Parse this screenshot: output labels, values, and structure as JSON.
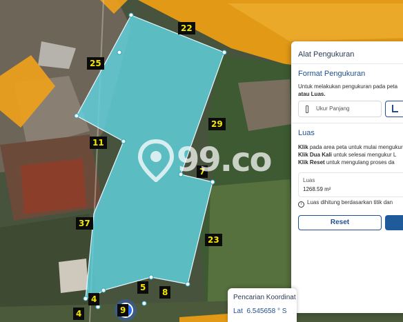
{
  "colors": {
    "parcel_fill": "#5fd3df",
    "parcel_stroke": "#e8f8ff",
    "zone_orange": "#f0a21a",
    "label_bg": "#0b0b0b",
    "label_text": "#f2e600",
    "accent": "#1f4f8f"
  },
  "parcel_labels": [
    {
      "id": "22",
      "text": "22"
    },
    {
      "id": "25",
      "text": "25"
    },
    {
      "id": "29",
      "text": "29"
    },
    {
      "id": "11",
      "text": "11"
    },
    {
      "id": "7",
      "text": "7"
    },
    {
      "id": "37",
      "text": "37"
    },
    {
      "id": "23",
      "text": "23"
    },
    {
      "id": "5",
      "text": "5"
    },
    {
      "id": "8",
      "text": "8"
    },
    {
      "id": "4a",
      "text": "4"
    },
    {
      "id": "4b",
      "text": "4"
    },
    {
      "id": "9",
      "text": "9"
    }
  ],
  "watermark": {
    "text": "99.co",
    "icon": "location-pin-icon"
  },
  "panel": {
    "title": "Alat Pengukuran",
    "format": {
      "title": "Format Pengukuran",
      "desc_line1": "Untuk melakukan pengukuran pada peta",
      "desc_line2": "atau Luas.",
      "option_length": "Ukur Panjang",
      "option_length_icon": "ruler-icon",
      "option_area_icon": "area-angle-icon"
    },
    "area": {
      "title": "Luas",
      "instr1_bold": "Klik",
      "instr1": "pada area peta untuk mulai mengukur",
      "instr2_bold": "Klik Dua Kali",
      "instr2": "untuk selesai mengukur L",
      "instr3_bold": "Klik Reset",
      "instr3": "untuk mengulang proses da",
      "result_label": "Luas",
      "result_value": "1268.59 m²",
      "info": "Luas dihitung berdasarkan titik dan",
      "reset_label": "Reset"
    }
  },
  "coordinate": {
    "title": "Pencarian Koordinat",
    "lat_label": "Lat",
    "lat_value": "6.545658 ° S"
  }
}
